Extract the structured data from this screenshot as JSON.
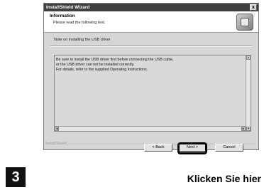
{
  "window": {
    "title": "InstallShield Wizard",
    "close_label": "x"
  },
  "header": {
    "title": "Information",
    "subtitle": "Please read the following text.",
    "icon": "installer-box-icon"
  },
  "note": "Note on installing the USB driver",
  "textbox": {
    "lines": [
      "Be sure to install the USB driver first before connecting the USB cable,",
      "or the USB driver can not be installed correctly.",
      "For details, refer to the supplied Operating Instructions."
    ]
  },
  "footer": {
    "brand": "InstallShield"
  },
  "buttons": {
    "back": "< Back",
    "next": "Next >",
    "cancel": "Cancel"
  },
  "annotation": {
    "step_number": "3",
    "caption": "Klicken Sie hier"
  }
}
